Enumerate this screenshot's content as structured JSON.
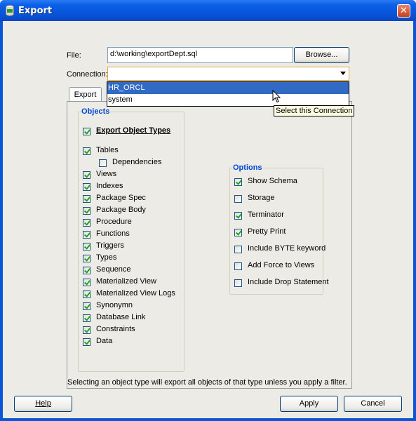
{
  "window": {
    "title": "Export",
    "close_glyph": "✕",
    "icon": "database-icon"
  },
  "file": {
    "label": "File:",
    "value": "d:\\working\\exportDept.sql",
    "browse_label": "Browse..."
  },
  "connection": {
    "label": "Connection:",
    "value": "",
    "options": [
      "HR_ORCL",
      "system"
    ],
    "highlighted": "HR_ORCL",
    "tooltip": "Select this Connection"
  },
  "tab": {
    "label": "Export"
  },
  "objects": {
    "title": "Objects",
    "header_item": {
      "label": "Export Object Types",
      "checked": true
    },
    "items": [
      {
        "label": "Tables",
        "checked": true
      },
      {
        "label": "Dependencies",
        "checked": false
      },
      {
        "label": "Views",
        "checked": true
      },
      {
        "label": "Indexes",
        "checked": true
      },
      {
        "label": "Package Spec",
        "checked": true
      },
      {
        "label": "Package Body",
        "checked": true
      },
      {
        "label": "Procedure",
        "checked": true
      },
      {
        "label": "Functions",
        "checked": true
      },
      {
        "label": "Triggers",
        "checked": true
      },
      {
        "label": "Types",
        "checked": true
      },
      {
        "label": "Sequence",
        "checked": true
      },
      {
        "label": "Materialized View",
        "checked": true
      },
      {
        "label": "Materialized View Logs",
        "checked": true
      },
      {
        "label": "Synonymn",
        "checked": true
      },
      {
        "label": "Database Link",
        "checked": true
      },
      {
        "label": "Constraints",
        "checked": true
      },
      {
        "label": "Data",
        "checked": true
      }
    ]
  },
  "options": {
    "title": "Options",
    "items": [
      {
        "label": "Show Schema",
        "checked": true
      },
      {
        "label": "Storage",
        "checked": false
      },
      {
        "label": "Terminator",
        "checked": true
      },
      {
        "label": "Pretty Print",
        "checked": true
      },
      {
        "label": "Include BYTE keyword",
        "checked": false
      },
      {
        "label": "Add Force to Views",
        "checked": false
      },
      {
        "label": "Include Drop Statement",
        "checked": false
      }
    ]
  },
  "hint": "Selecting an object type will export all objects of that type unless you apply a filter.",
  "buttons": {
    "help": "Help",
    "apply": "Apply",
    "cancel": "Cancel"
  },
  "colors": {
    "titlebar": "#0a5fe6",
    "accent": "#316ac5",
    "group_title": "#0046d5",
    "check": "#21a121"
  }
}
